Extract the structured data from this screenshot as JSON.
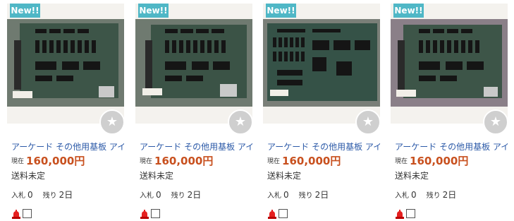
{
  "listings": [
    {
      "badge": "New!!",
      "title": "アーケード その他用基板 アイレ…",
      "price_label": "現在",
      "price": "160,000円",
      "shipping": "送料未定",
      "bids_label": "入札",
      "bids": "0",
      "remaining_label": "残り",
      "remaining": "2日"
    },
    {
      "badge": "New!!",
      "title": "アーケード その他用基板 アイレ…",
      "price_label": "現在",
      "price": "160,000円",
      "shipping": "送料未定",
      "bids_label": "入札",
      "bids": "0",
      "remaining_label": "残り",
      "remaining": "2日"
    },
    {
      "badge": "New!!",
      "title": "アーケード その他用基板 アイレ…",
      "price_label": "現在",
      "price": "160,000円",
      "shipping": "送料未定",
      "bids_label": "入札",
      "bids": "0",
      "remaining_label": "残り",
      "remaining": "2日"
    },
    {
      "badge": "New!!",
      "title": "アーケード その他用基板 アイレ…",
      "price_label": "現在",
      "price": "160,000円",
      "shipping": "送料未定",
      "bids_label": "入札",
      "bids": "0",
      "remaining_label": "残り",
      "remaining": "2日"
    }
  ],
  "icons": {
    "favorite": "star-icon",
    "alert": "red-siren-icon",
    "watch": "checkbox-icon"
  },
  "colors": {
    "badge": "#4fb7c6",
    "price": "#c8501e",
    "title_link": "#2c5aa8",
    "board": "#3d5548"
  }
}
